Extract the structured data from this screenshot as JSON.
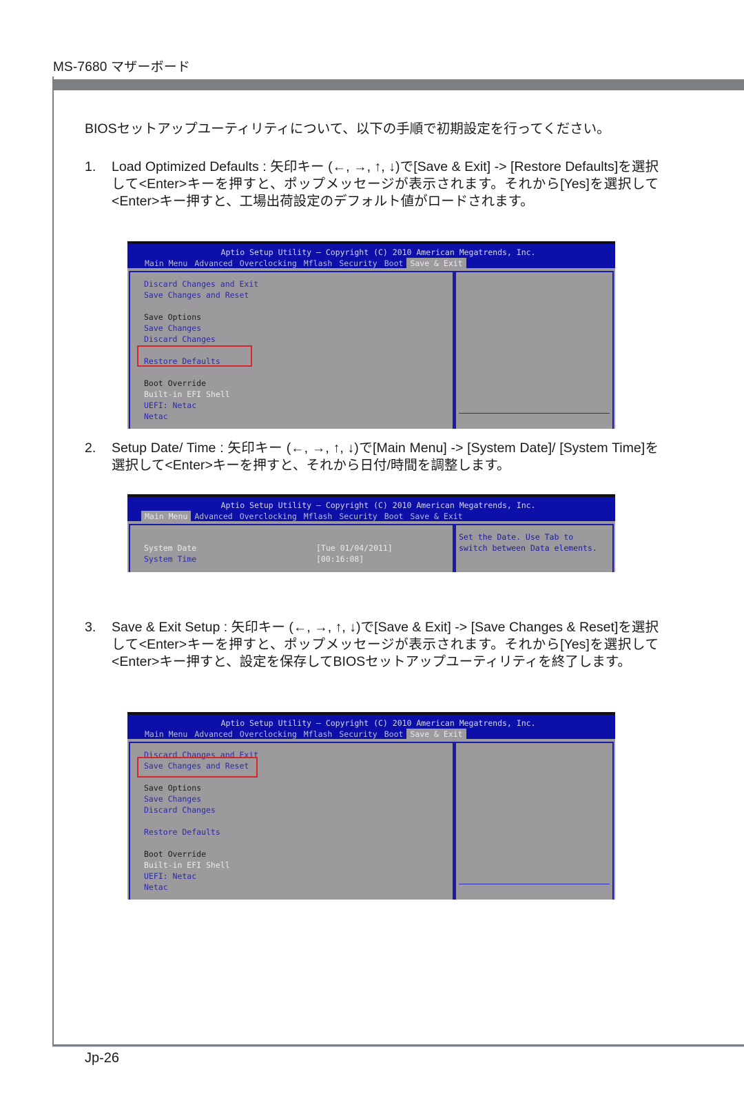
{
  "header": {
    "title": "MS-7680 マザーボード"
  },
  "intro": "BIOSセットアップユーティリティについて、以下の手順で初期設定を行ってください。",
  "steps": [
    {
      "number": "1.",
      "text": "Load Optimized Defaults : 矢印キー (←, →, ↑, ↓)で[Save & Exit] -> [Restore Defaults]を選択して<Enter>キーを押すと、ポップメッセージが表示されます。それから[Yes]を選択して<Enter>キー押すと、工場出荷設定のデフォルト値がロードされます。"
    },
    {
      "number": "2.",
      "text": "Setup Date/ Time : 矢印キー (←, →, ↑, ↓)で[Main Menu]  -> [System Date]/ [System Time]を選択して<Enter>キーを押すと、それから日付/時間を調整します。"
    },
    {
      "number": "3.",
      "text": "Save & Exit Setup :  矢印キー (←, →, ↑, ↓)で[Save & Exit] -> [Save Changes & Reset]を選択して<Enter>キーを押すと、ポップメッセージが表示されます。それから[Yes]を選択して<Enter>キー押すと、設定を保存してBIOSセットアップユーティリティを終了します。"
    }
  ],
  "bios": {
    "title": "Aptio Setup Utility – Copyright (C) 2010 American Megatrends, Inc.",
    "tabs": [
      "Main Menu",
      "Advanced",
      "Overclocking",
      "Mflash",
      "Security",
      "Boot",
      "Save & Exit"
    ],
    "save_exit_items": {
      "discard_exit": "Discard Changes and Exit",
      "save_reset": "Save Changes and Reset",
      "save_options": "Save Options",
      "save_changes": "Save Changes",
      "discard_changes": "Discard Changes",
      "restore_defaults": "Restore Defaults",
      "boot_override": "Boot Override",
      "efi_shell": "Built-in EFI Shell",
      "uefi_netac": "UEFI: Netac",
      "netac": "Netac"
    },
    "main_menu": {
      "system_date_label": "System Date",
      "system_date_value": "[Tue 01/04/2011]",
      "system_time_label": "System Time",
      "system_time_value": "[00:16:08]",
      "help": "Set the Date. Use Tab to\nswitch between Data elements."
    },
    "screens": [
      {
        "active_tab": "Save & Exit",
        "highlighted": "Restore Defaults"
      },
      {
        "active_tab": "Main Menu",
        "highlighted": ""
      },
      {
        "active_tab": "Save & Exit",
        "highlighted": "Save Changes and Reset"
      }
    ]
  },
  "footer": {
    "page_number": "Jp-26"
  },
  "colors": {
    "bios_header": "#0c10a8",
    "bios_body": "#9c9a9d",
    "highlight_box": "#d8262e",
    "rule_gray": "#7d8082"
  }
}
